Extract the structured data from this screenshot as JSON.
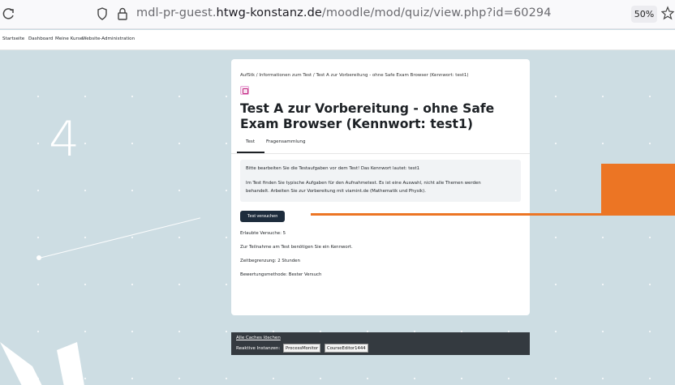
{
  "browser": {
    "url_prefix": "mdl-pr-guest.",
    "url_host": "htwg-konstanz.de",
    "url_path": "/moodle/mod/quiz/view.php?id=60294",
    "zoom": "50%"
  },
  "navbar": {
    "items": [
      "Startseite",
      "Dashboard",
      "Meine Kurse",
      "Website-Administration"
    ]
  },
  "background": {
    "big_number": "4"
  },
  "card": {
    "breadcrumb": "AufStk / Informationen zum Test / Test A zur Vorbereitung - ohne Safe Exam Browser (Kennwort: test1)",
    "title": "Test A zur Vorbereitung - ohne Safe Exam Browser (Kennwort: test1)",
    "tabs": [
      "Test",
      "Fragensammlung"
    ],
    "info": {
      "line1": "Bitte bearbeiten Sie die Testaufgaben vor dem Test! Das Kennwort lautet: test1",
      "line2": "Im Test finden Sie typische Aufgaben für den Aufnahmetest. Es ist eine Auswahl, nicht alle Themen werden",
      "line3": "behandelt. Arbeiten Sie zur Vorbereitung mit viamint.de (Mathematik und Physik)."
    },
    "attempt_button": "Test versuchen",
    "meta": {
      "attempts": "Erlaubte Versuche: 5",
      "password_note": "Zur Teilnahme am Test benötigen Sie ein Kennwort.",
      "time_limit": "Zeitbegrenzung: 2 Stunden",
      "grading": "Bewertungsmethode: Bester Versuch"
    }
  },
  "footer": {
    "purge_caches": "Alle Caches löschen",
    "reactive_label": "Reaktive Instanzen:",
    "instances": [
      "ProcessMonitor",
      "CourseEditor1444"
    ]
  },
  "colors": {
    "accent_orange": "#ec7524",
    "button_dark": "#1d2c3c",
    "background": "#cddde3"
  }
}
